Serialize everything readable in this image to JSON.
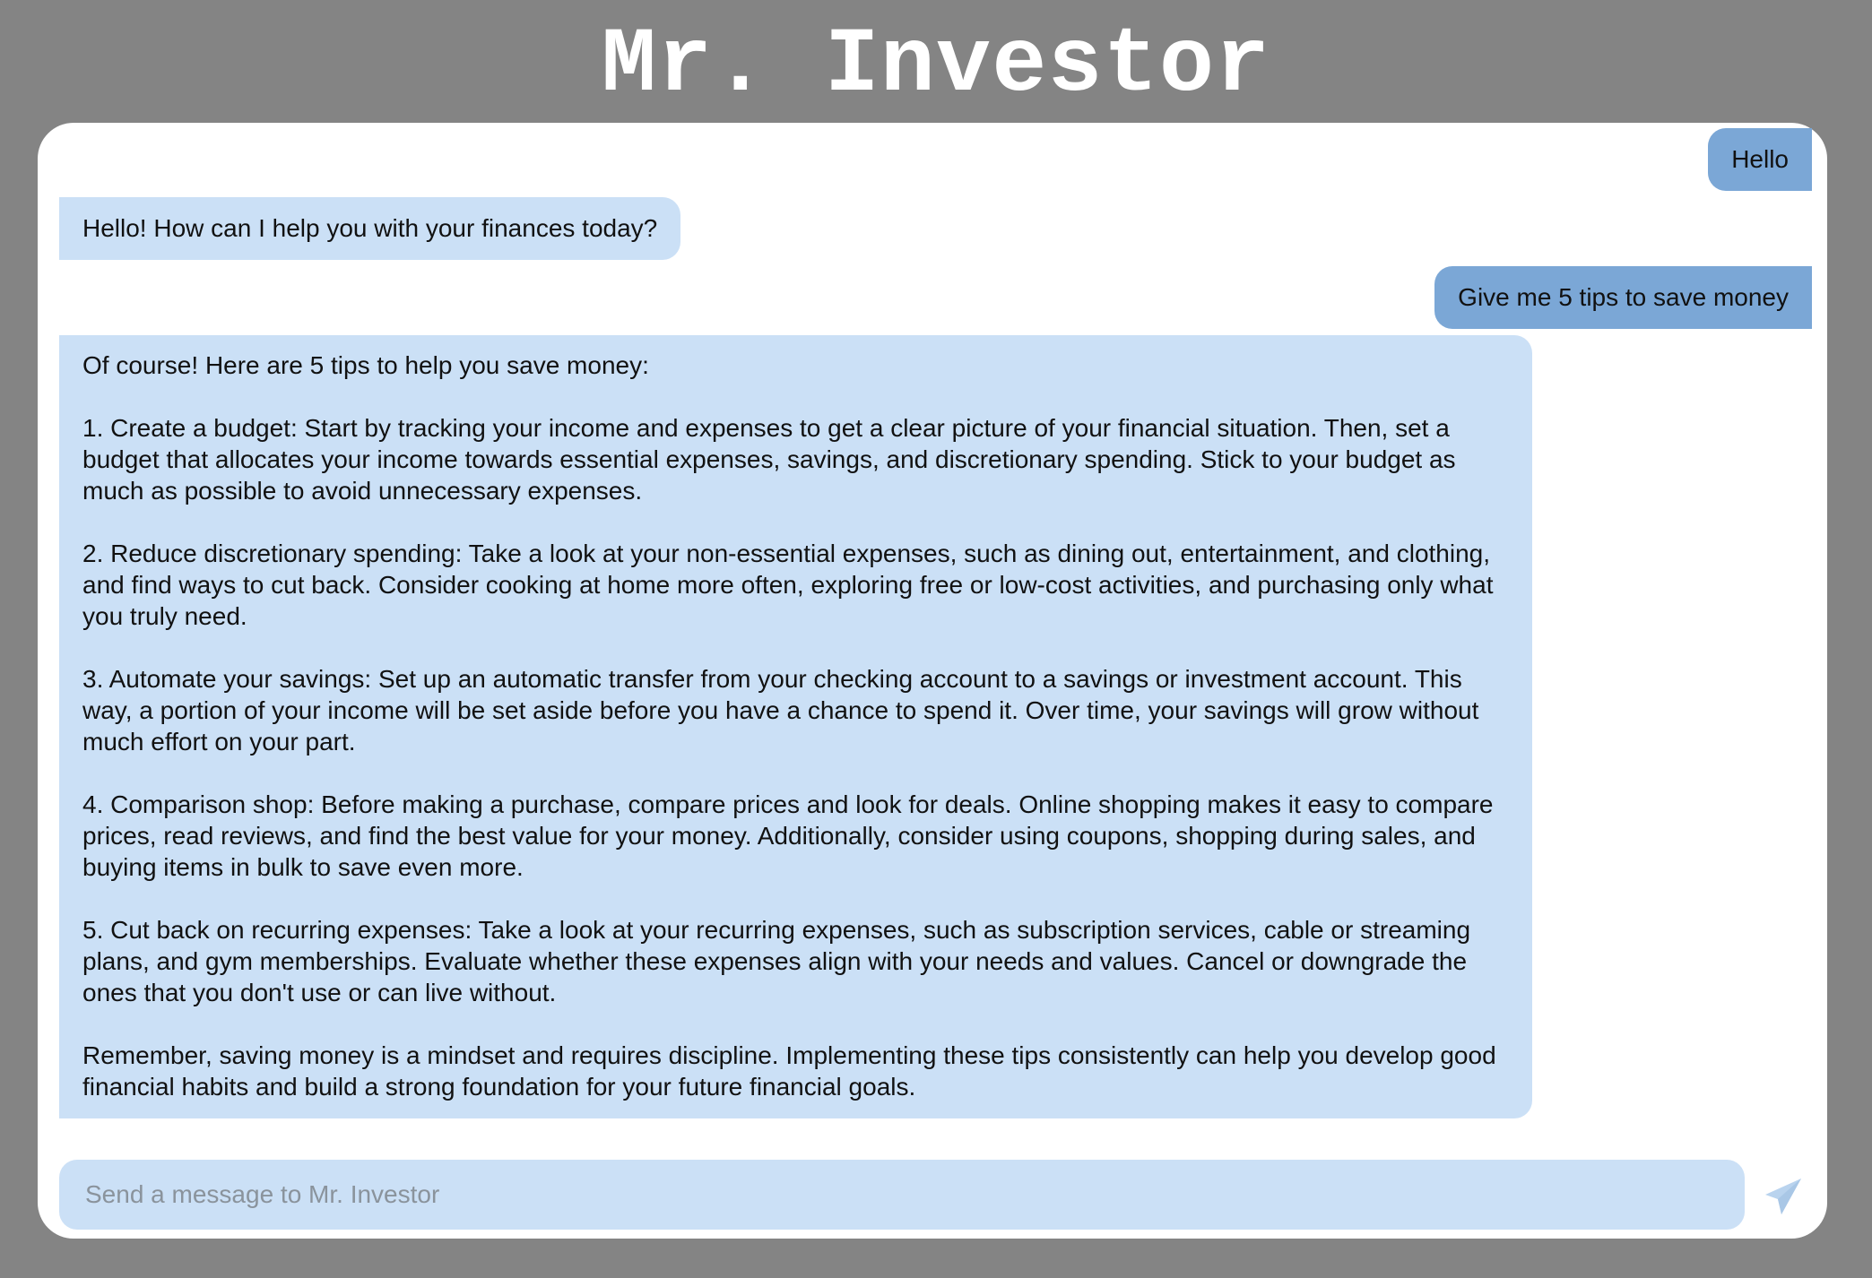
{
  "header": {
    "title": "Mr. Investor"
  },
  "conversation": {
    "messages": [
      {
        "role": "user",
        "text": "Hello"
      },
      {
        "role": "assistant",
        "text": "Hello! How can I help you with your finances today?"
      },
      {
        "role": "user",
        "text": "Give me 5 tips to save money"
      },
      {
        "role": "assistant",
        "text": "Of course! Here are 5 tips to help you save money:\n\n1. Create a budget: Start by tracking your income and expenses to get a clear picture of your financial situation. Then, set a budget that allocates your income towards essential expenses, savings, and discretionary spending. Stick to your budget as much as possible to avoid unnecessary expenses.\n\n2. Reduce discretionary spending: Take a look at your non-essential expenses, such as dining out, entertainment, and clothing, and find ways to cut back. Consider cooking at home more often, exploring free or low-cost activities, and purchasing only what you truly need.\n\n3. Automate your savings: Set up an automatic transfer from your checking account to a savings or investment account. This way, a portion of your income will be set aside before you have a chance to spend it. Over time, your savings will grow without much effort on your part.\n\n4. Comparison shop: Before making a purchase, compare prices and look for deals. Online shopping makes it easy to compare prices, read reviews, and find the best value for your money. Additionally, consider using coupons, shopping during sales, and buying items in bulk to save even more.\n\n5. Cut back on recurring expenses: Take a look at your recurring expenses, such as subscription services, cable or streaming plans, and gym memberships. Evaluate whether these expenses align with your needs and values. Cancel or downgrade the ones that you don't use or can live without.\n\nRemember, saving money is a mindset and requires discipline. Implementing these tips consistently can help you develop good financial habits and build a strong foundation for your future financial goals."
      }
    ]
  },
  "composer": {
    "placeholder": "Send a message to Mr. Investor",
    "value": "",
    "send_icon": "paper-plane-icon"
  },
  "colors": {
    "background": "#848484",
    "card": "#ffffff",
    "user_bubble": "#7ba7d6",
    "assistant_bubble": "#cbe0f6",
    "send_icon": "#b9d3ee"
  }
}
